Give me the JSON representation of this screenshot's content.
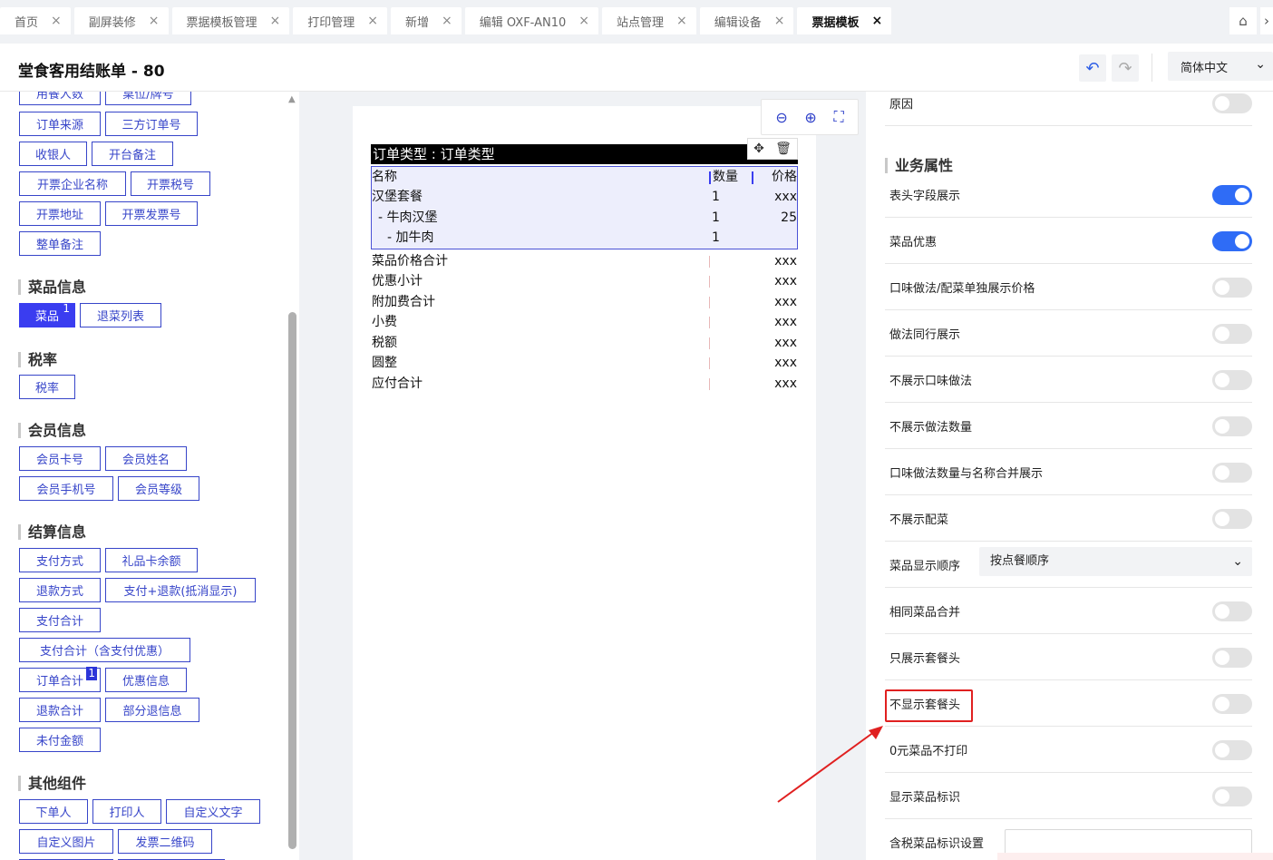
{
  "tabs": [
    {
      "label": "首页",
      "active": false
    },
    {
      "label": "副屏装修",
      "active": false
    },
    {
      "label": "票据模板管理",
      "active": false
    },
    {
      "label": "打印管理",
      "active": false
    },
    {
      "label": "新增",
      "active": false
    },
    {
      "label": "编辑 OXF-AN10",
      "active": false
    },
    {
      "label": "站点管理",
      "active": false
    },
    {
      "label": "编辑设备",
      "active": false
    },
    {
      "label": "票据模板",
      "active": true
    }
  ],
  "tab_close_glyph": "×",
  "tab_icons": {
    "home": "home-icon",
    "more": "more-icon"
  },
  "header": {
    "title": "堂食客用结账单 - 80",
    "language": "简体中文",
    "undo_icon": "undo-icon",
    "redo_icon": "redo-icon"
  },
  "left": {
    "top_partial": [
      "用餐人数",
      "桌位/牌号"
    ],
    "basic_chips": [
      "订单来源",
      "三方订单号",
      "收银人",
      "开台备注",
      "开票企业名称",
      "开票税号",
      "开票地址",
      "开票发票号",
      "整单备注"
    ],
    "dish_section": {
      "title": "菜品信息",
      "chips": [
        "菜品",
        "退菜列表"
      ],
      "badge": "1"
    },
    "tax_section": {
      "title": "税率",
      "chips": [
        "税率"
      ]
    },
    "member_section": {
      "title": "会员信息",
      "chips": [
        "会员卡号",
        "会员姓名",
        "会员手机号",
        "会员等级"
      ]
    },
    "settle_section": {
      "title": "结算信息",
      "chips": [
        "支付方式",
        "礼品卡余额",
        "退款方式",
        "支付+退款(抵消显示)",
        "支付合计",
        "支付合计（含支付优惠）",
        "订单合计",
        "优惠信息",
        "退款合计",
        "部分退信息",
        "未付金额"
      ],
      "badge": "1"
    },
    "other_section": {
      "title": "其他组件",
      "chips": [
        "下单人",
        "打印人",
        "自定义文字",
        "自定义图片",
        "发票二维码"
      ]
    }
  },
  "canvas": {
    "zoom_icons": [
      "zoom-out-icon",
      "zoom-in-icon",
      "fit-screen-icon"
    ],
    "order_type": "订单类型 : 订单类型",
    "tool_icons": [
      "move-icon",
      "trash-icon"
    ],
    "table_header": {
      "name": "名称",
      "qty": "数量",
      "price": "价格"
    },
    "table_rows": [
      {
        "name": "汉堡套餐",
        "qty": "1",
        "price": "xxx"
      },
      {
        "name": " - 牛肉汉堡",
        "qty": "1",
        "price": "25"
      },
      {
        "name": "   - 加牛肉",
        "qty": "1",
        "price": ""
      }
    ],
    "summary_rows": [
      {
        "label": "菜品价格合计",
        "value": "xxx"
      },
      {
        "label": "优惠小计",
        "value": "xxx"
      },
      {
        "label": "附加费合计",
        "value": "xxx"
      },
      {
        "label": "小费",
        "value": "xxx"
      },
      {
        "label": "税额",
        "value": "xxx"
      },
      {
        "label": "圆整",
        "value": "xxx"
      },
      {
        "label": "应付合计",
        "value": "xxx"
      }
    ]
  },
  "right": {
    "top_partial_label": "原因",
    "section_title": "业务属性",
    "rows": [
      {
        "label": "表头字段展示",
        "type": "toggle",
        "on": true
      },
      {
        "label": "菜品优惠",
        "type": "toggle",
        "on": true
      },
      {
        "label": "口味做法/配菜单独展示价格",
        "type": "toggle",
        "on": false
      },
      {
        "label": "做法同行展示",
        "type": "toggle",
        "on": false
      },
      {
        "label": "不展示口味做法",
        "type": "toggle",
        "on": false
      },
      {
        "label": "不展示做法数量",
        "type": "toggle",
        "on": false
      },
      {
        "label": "口味做法数量与名称合并展示",
        "type": "toggle",
        "on": false
      },
      {
        "label": "不展示配菜",
        "type": "toggle",
        "on": false
      },
      {
        "label": "菜品显示顺序",
        "type": "select",
        "value": "按点餐顺序"
      },
      {
        "label": "相同菜品合并",
        "type": "toggle",
        "on": false
      },
      {
        "label": "只展示套餐头",
        "type": "toggle",
        "on": false
      },
      {
        "label": "不显示套餐头",
        "type": "toggle",
        "on": false
      },
      {
        "label": "0元菜品不打印",
        "type": "toggle",
        "on": false
      },
      {
        "label": "显示菜品标识",
        "type": "toggle",
        "on": false
      },
      {
        "label": "含税菜品标识设置",
        "type": "input",
        "value": ""
      }
    ]
  },
  "colors": {
    "accent": "#3a3df0",
    "toggle_on": "#2f6cf6",
    "highlight": "#e02020"
  }
}
